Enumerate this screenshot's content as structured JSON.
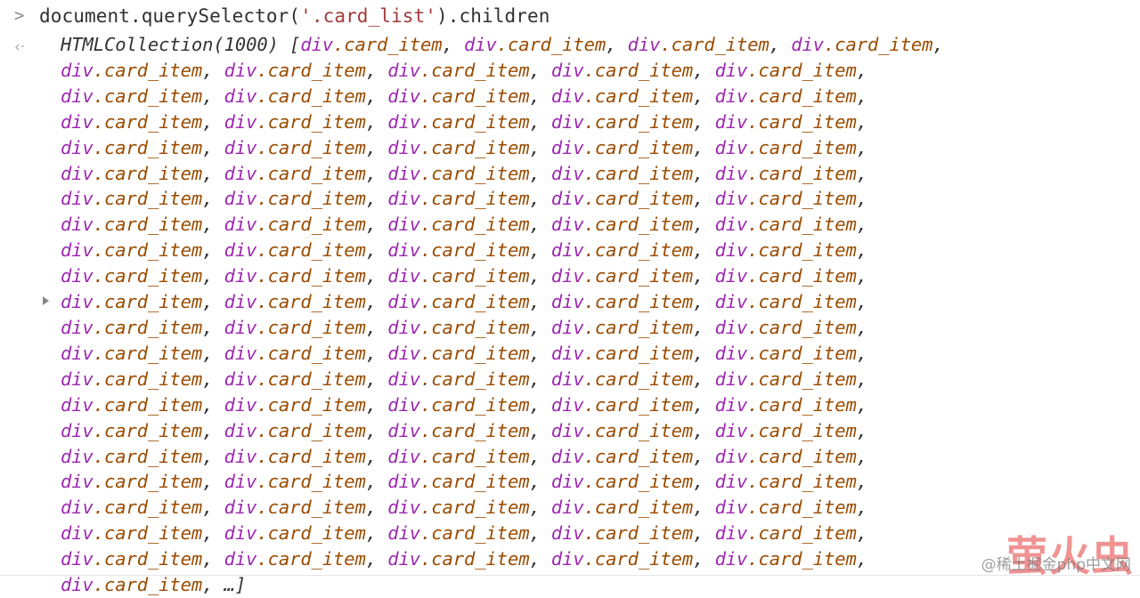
{
  "console": {
    "prompt_icon": ">",
    "return_icon": "‹·",
    "expand_icon": "▶",
    "command": {
      "before_string": "document.querySelector(",
      "string": "'.card_list'",
      "after_string": ").children"
    },
    "result": {
      "header": "HTMLCollection(1000) ",
      "open_bracket": "[",
      "tag": "div",
      "class": ".card_item",
      "separator": ", ",
      "ellipsis": "…",
      "close_bracket": "]",
      "collection_type": "HTMLCollection",
      "collection_length": 1000,
      "items_first_line": 4,
      "items_per_line": 5,
      "continuation_lines": 20,
      "last_line_items": 1
    }
  },
  "colors": {
    "background": "#ffffff",
    "command_text": "#303030",
    "string_literal": "#a33a3a",
    "tag_name": "#9c27b0",
    "class_name": "#9a4b00",
    "punctuation": "#333333",
    "prompt_icon": "#8b8b8b",
    "return_icon": "#a8a8a8",
    "expand_icon": "#888888",
    "watermark_red": "#e85050",
    "watermark_gray": "#787878",
    "rule": "#e6e6e6"
  },
  "watermarks": {
    "red": "萤火虫",
    "gray": "@稀土掘金php中文网"
  }
}
